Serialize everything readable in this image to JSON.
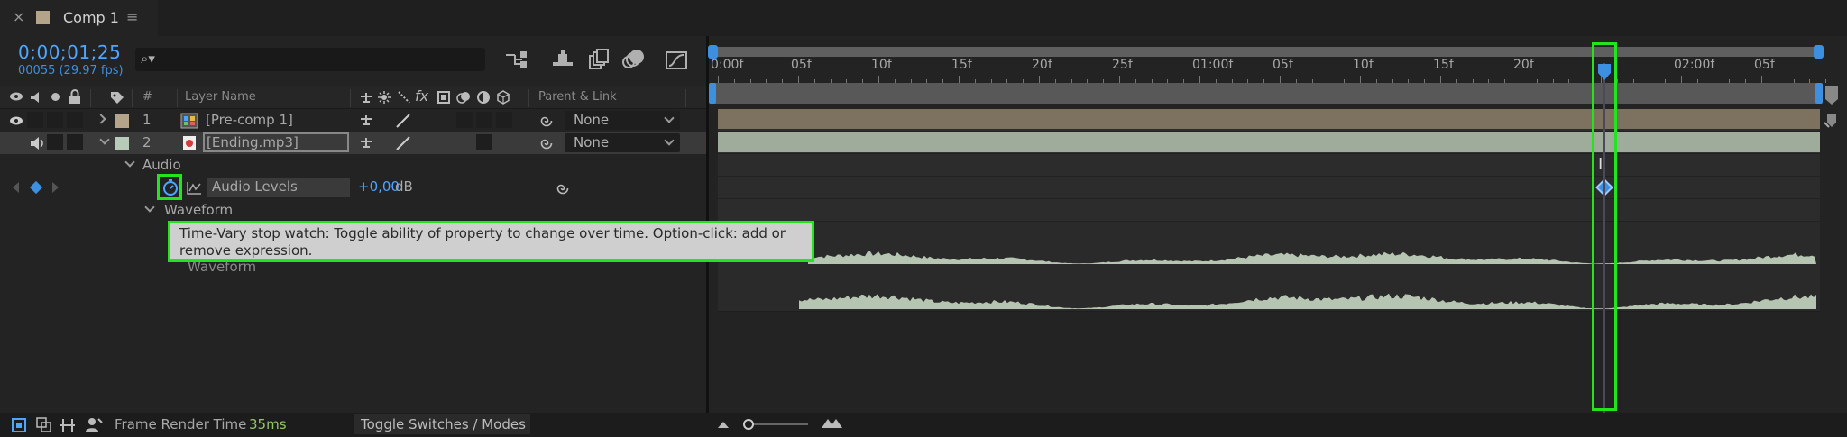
{
  "tab": {
    "close": "×",
    "title": "Comp 1",
    "menu": "≡",
    "swatch_color": "#b4a58a"
  },
  "header": {
    "timecode": "0;00;01;25",
    "frame_info": "00055 (29.97 fps)",
    "search_icon": "⌕▾"
  },
  "toolbar_icons": [
    "comp-flowchart-icon",
    "draft-3d-icon",
    "frame-blending-icon",
    "motion-blur-icon",
    "graph-editor-icon"
  ],
  "columns": {
    "hash": "#",
    "layer_name": "Layer Name",
    "parent_link": "Parent & Link"
  },
  "layers": [
    {
      "index": "1",
      "name": "[Pre-comp 1]",
      "parent": "None",
      "color": "#b4a58a"
    },
    {
      "index": "2",
      "name": "[Ending.mp3]",
      "parent": "None",
      "color": "#b7cbb8"
    }
  ],
  "audio_group": {
    "label": "Audio"
  },
  "audio_levels": {
    "label": "Audio Levels",
    "value": "+0,00",
    "unit": "dB"
  },
  "waveform_group": {
    "label": "Waveform"
  },
  "waveform_property": {
    "label": "Waveform"
  },
  "tooltip": {
    "text": "Time-Vary stop watch: Toggle ability of property to change over time. Option-click: add or remove expression."
  },
  "ruler": {
    "labels": [
      "0:00f",
      "05f",
      "10f",
      "15f",
      "20f",
      "25f",
      "01:00f",
      "05f",
      "10f",
      "15f",
      "20f",
      "",
      "02:00f",
      "05f"
    ]
  },
  "footer": {
    "render_label": "Frame Render Time",
    "render_value": "35ms",
    "toggle_label": "Toggle Switches / Modes"
  },
  "colors": {
    "accent": "#3d8fe0",
    "highlight": "#22e51e",
    "render_value": "#93c56a"
  }
}
